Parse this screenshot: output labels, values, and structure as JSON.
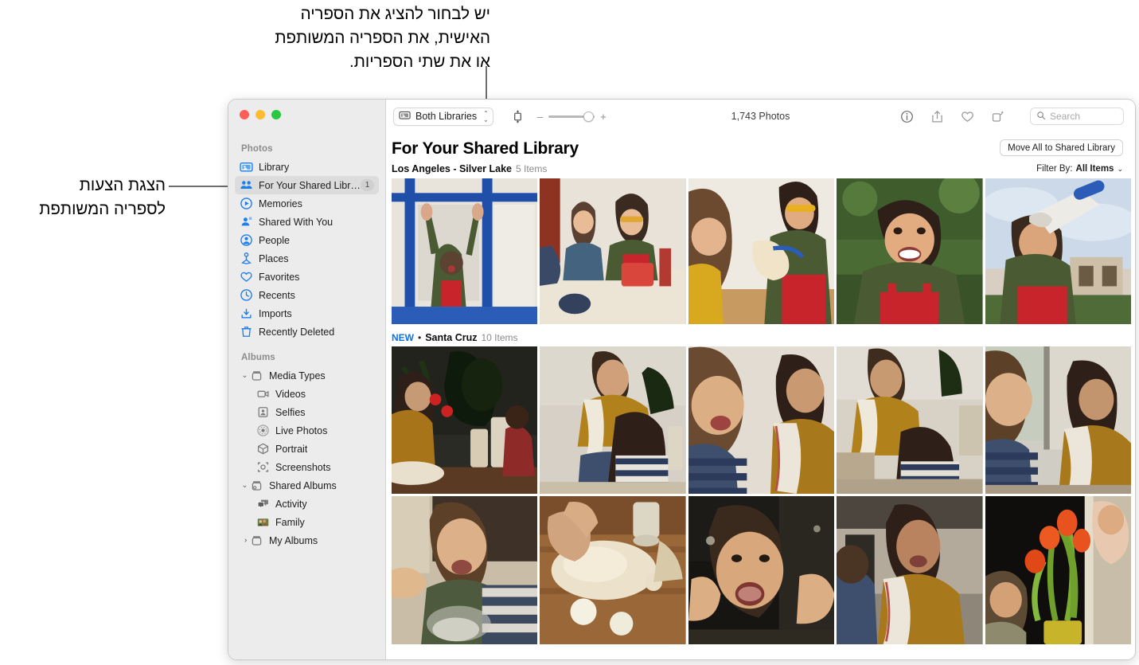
{
  "callouts": {
    "top": "יש לבחור להציג את הספריה\nהאישית, את הספריה המשותפת\nאו את שתי הספריות.",
    "left": "הצגת הצעות\nלספריה המשותפת"
  },
  "window": {
    "traffic_lights": [
      "close",
      "minimize",
      "zoom"
    ]
  },
  "toolbar": {
    "library_picker": "Both Libraries",
    "library_picker_icon": "photos-library-icon",
    "aspect_icon": "aspect-ratio-icon",
    "zoom_out_sign": "–",
    "zoom_in_sign": "+",
    "photo_count": "1,743 Photos",
    "buttons": [
      {
        "name": "info-icon",
        "label": "Info"
      },
      {
        "name": "share-icon",
        "label": "Share"
      },
      {
        "name": "favorite-heart-icon",
        "label": "Favorite"
      },
      {
        "name": "rotate-icon",
        "label": "Rotate"
      }
    ],
    "search_placeholder": "Search",
    "search_value": ""
  },
  "sidebar": {
    "sections": [
      {
        "title": "Photos",
        "items": [
          {
            "label": "Library",
            "icon": "library-icon",
            "selected": false,
            "badge": ""
          },
          {
            "label": "For Your Shared Library",
            "icon": "shared-library-people-icon",
            "selected": true,
            "badge": "1"
          },
          {
            "label": "Memories",
            "icon": "memories-play-icon",
            "selected": false,
            "badge": ""
          },
          {
            "label": "Shared With You",
            "icon": "shared-with-you-icon",
            "selected": false,
            "badge": ""
          },
          {
            "label": "People",
            "icon": "people-icon",
            "selected": false,
            "badge": ""
          },
          {
            "label": "Places",
            "icon": "places-pin-icon",
            "selected": false,
            "badge": ""
          },
          {
            "label": "Favorites",
            "icon": "heart-icon",
            "selected": false,
            "badge": ""
          },
          {
            "label": "Recents",
            "icon": "clock-icon",
            "selected": false,
            "badge": ""
          },
          {
            "label": "Imports",
            "icon": "import-arrow-icon",
            "selected": false,
            "badge": ""
          },
          {
            "label": "Recently Deleted",
            "icon": "trash-icon",
            "selected": false,
            "badge": ""
          }
        ]
      },
      {
        "title": "Albums",
        "items": [
          {
            "label": "Media Types",
            "icon": "album-folder-icon",
            "disclosure": "open",
            "sub": false
          },
          {
            "label": "Videos",
            "icon": "video-camera-icon",
            "sub": true
          },
          {
            "label": "Selfies",
            "icon": "selfie-icon",
            "sub": true
          },
          {
            "label": "Live Photos",
            "icon": "live-photo-icon",
            "sub": true
          },
          {
            "label": "Portrait",
            "icon": "portrait-cube-icon",
            "sub": true
          },
          {
            "label": "Screenshots",
            "icon": "screenshot-icon",
            "sub": true
          },
          {
            "label": "Shared Albums",
            "icon": "shared-album-icon",
            "disclosure": "open",
            "sub": false
          },
          {
            "label": "Activity",
            "icon": "activity-bubbles-icon",
            "sub": true
          },
          {
            "label": "Family",
            "icon": "family-album-thumbnail",
            "sub": true
          },
          {
            "label": "My Albums",
            "icon": "album-folder-icon",
            "disclosure": "closed",
            "sub": false
          }
        ]
      }
    ]
  },
  "main": {
    "title": "For Your Shared Library",
    "move_all_button": "Move All to Shared Library",
    "filter_prefix": "Filter By:",
    "filter_value": "All Items",
    "sections": [
      {
        "new": "",
        "name": "Los Angeles - Silver Lake",
        "count": "5 Items",
        "photos": [
          {
            "alt": "child-at-blue-window",
            "id": "p1"
          },
          {
            "alt": "two-boys-on-bed-with-box",
            "id": "p2"
          },
          {
            "alt": "girl-and-boy-with-ukulele",
            "id": "p3"
          },
          {
            "alt": "smiling-boy-in-red-overalls",
            "id": "p4"
          },
          {
            "alt": "boy-with-megaphone-outdoors",
            "id": "p5"
          }
        ]
      },
      {
        "new": "NEW",
        "name": "Santa Cruz",
        "count": "10 Items",
        "photos_row1": [
          {
            "alt": "woman-baking-with-plants",
            "id": "p6"
          },
          {
            "alt": "mother-and-son-kneading-dough",
            "id": "p7"
          },
          {
            "alt": "boy-laughing-with-mother",
            "id": "p8"
          },
          {
            "alt": "kids-at-kitchen-counter",
            "id": "p9"
          },
          {
            "alt": "boy-in-striped-shirt-by-window",
            "id": "p10"
          }
        ],
        "photos_row2": [
          {
            "alt": "boy-drinking-from-glass",
            "id": "p11"
          },
          {
            "alt": "hands-in-flour-on-table",
            "id": "p12"
          },
          {
            "alt": "boy-with-flour-on-face",
            "id": "p13"
          },
          {
            "alt": "woman-smiling-with-towel",
            "id": "p14"
          },
          {
            "alt": "boy-and-baby-with-tulips",
            "id": "p15"
          }
        ]
      }
    ]
  },
  "colors": {
    "accent_blue": "#0a73e8",
    "sidebar_bg": "#ececec",
    "selected_row": "#dcdcdc",
    "badge_bg": "#d0d0d0"
  }
}
